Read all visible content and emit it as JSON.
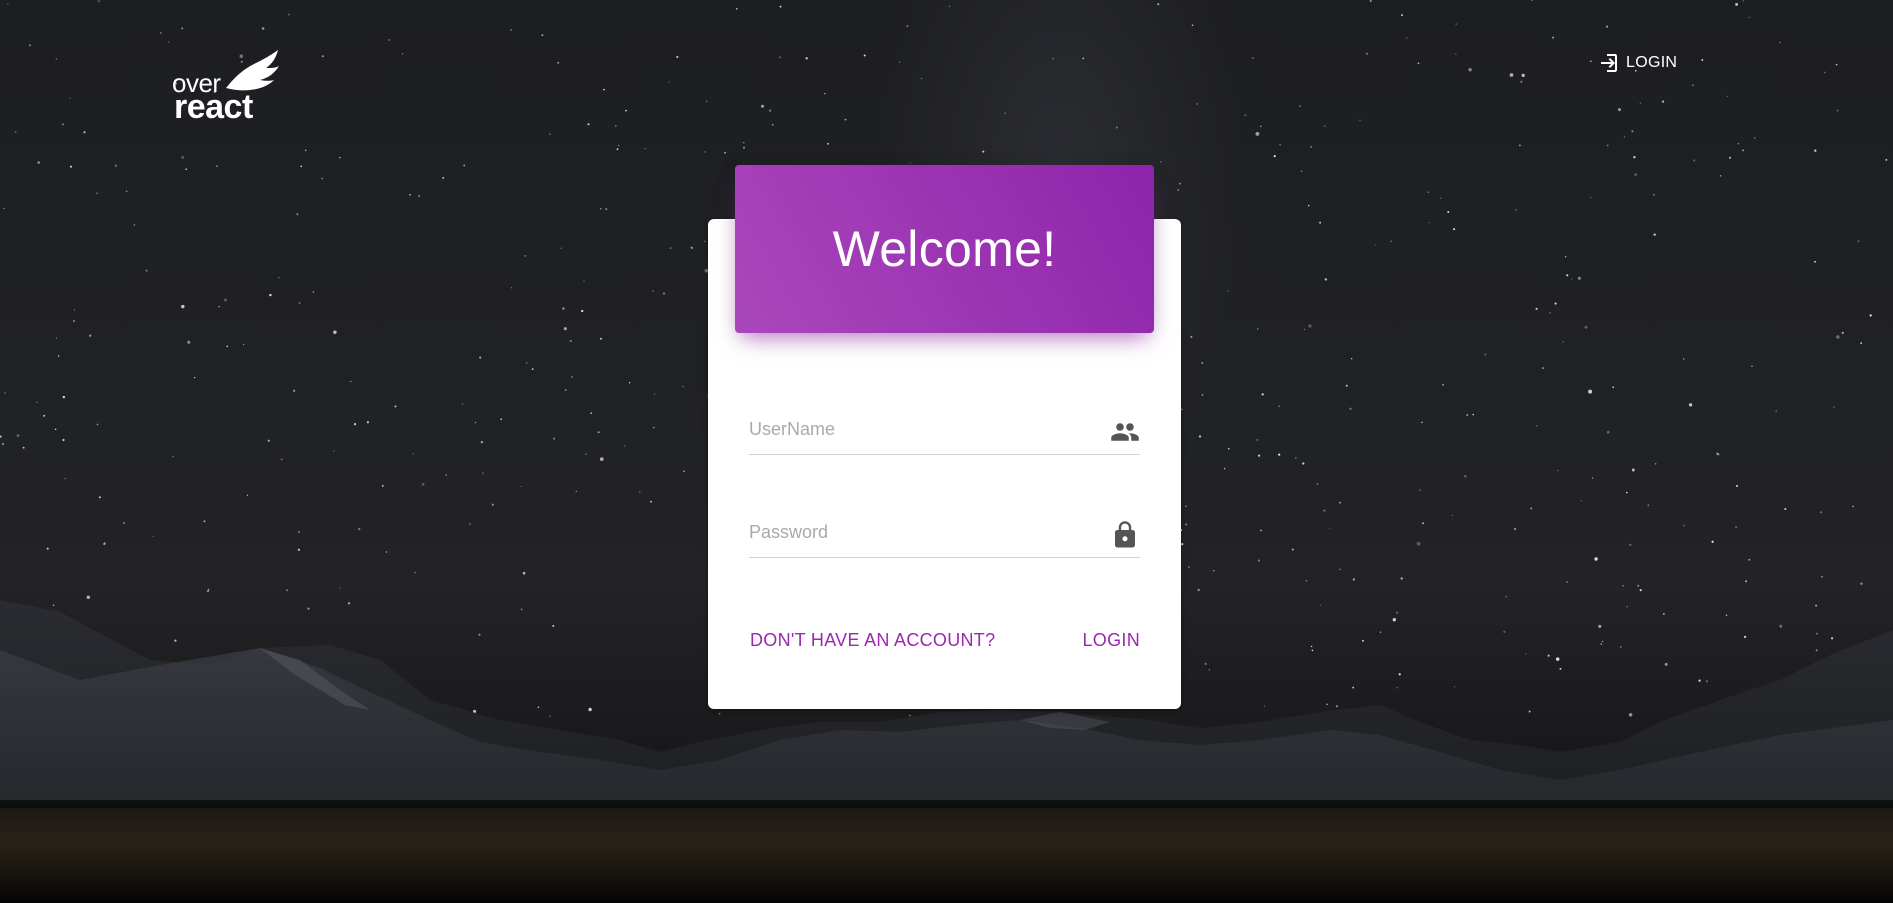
{
  "brand": {
    "logo_top": "over",
    "logo_bottom": "react"
  },
  "nav": {
    "login_label": "LOGIN",
    "login_icon": "login-icon"
  },
  "card": {
    "title": "Welcome!",
    "username": {
      "value": "",
      "placeholder": "UserName",
      "icon": "people-icon"
    },
    "password": {
      "value": "",
      "placeholder": "Password",
      "icon": "lock-icon"
    },
    "signup_label": "DON'T HAVE AN ACCOUNT?",
    "login_label": "LOGIN"
  },
  "colors": {
    "accent": "#9c27b0",
    "header_gradient_start": "#ab47bc",
    "header_gradient_end": "#8e24aa"
  }
}
